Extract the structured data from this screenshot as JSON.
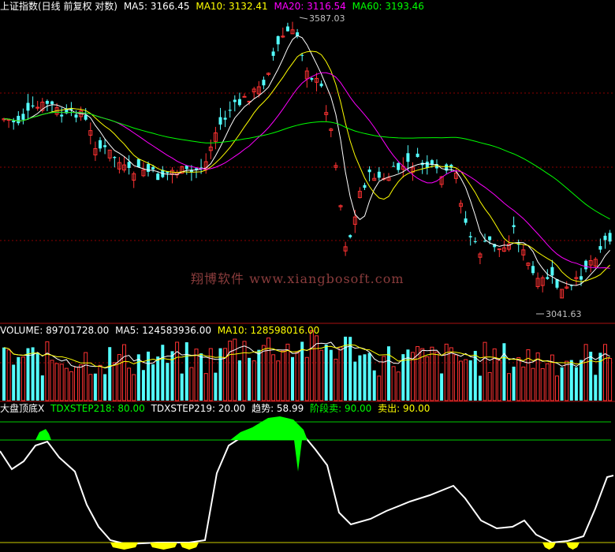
{
  "main_panel": {
    "index_name": "上证指数(日线 前复权 对数)",
    "ma5": "MA5: 3166.45",
    "ma10": "MA10: 3132.41",
    "ma20": "MA20: 3116.54",
    "ma60": "MA60: 3193.46",
    "high_label": "3587.03",
    "low_label": "3041.63",
    "watermark": "翔博软件 www.xiangbosoft.com"
  },
  "volume_panel": {
    "volume": "VOLUME: 89701728.00",
    "ma5": "MA5: 124583936.00",
    "ma10": "MA10: 128598016.00"
  },
  "indicator_panel": {
    "name": "大盘顶底X",
    "step218": "TDXSTEP218: 80.00",
    "step219": "TDXSTEP219: 20.00",
    "trend": "趋势: 58.99",
    "stage_sell": "阶段卖: 90.00",
    "sell": "卖出: 90.00"
  },
  "colors": {
    "background": "#000000",
    "up_candle": "#ff3232",
    "down_candle": "#54ffff",
    "ma5": "#ffffff",
    "ma10": "#ffff00",
    "ma20": "#ff00ff",
    "ma60": "#00ff00",
    "grid": "#8b0000",
    "trend_line": "#ffffff",
    "top_fill": "#00ff00",
    "bottom_fill": "#ffff00"
  },
  "chart_data": {
    "type": "candlestick",
    "title": "上证指数(日线 前复权 对数)",
    "annotations": [
      "3587.03",
      "3041.63"
    ],
    "indicator_levels": {
      "TDXSTEP218": 80,
      "TDXSTEP219": 20,
      "趋势": 58.99,
      "阶段卖": 90,
      "卖出": 90
    }
  }
}
